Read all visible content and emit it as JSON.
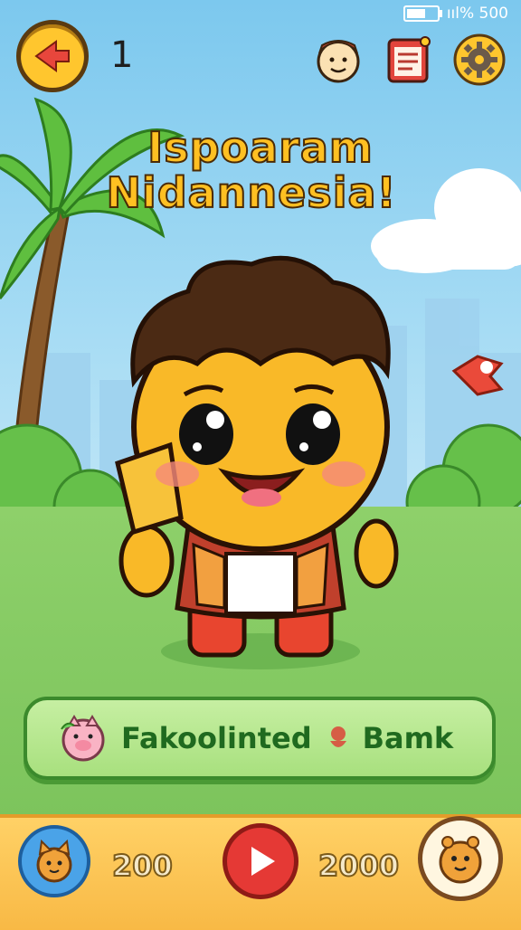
{
  "status": {
    "signal_text": "ııl% 500"
  },
  "header": {
    "level": "1",
    "icons": [
      "back-arrow-icon",
      "character-face-icon",
      "notebook-icon",
      "gear-icon"
    ]
  },
  "title": {
    "line1": "Ispoaram",
    "line2": "Nidannesia!"
  },
  "banner": {
    "text1": "Fakoolinted",
    "text2": "Bamk"
  },
  "bottom_bar": {
    "score_left": "200",
    "score_right": "2000"
  },
  "colors": {
    "gold": "#ffc62e",
    "play_red": "#e53935",
    "grass": "#8ed06a",
    "sky": "#7cc8ee"
  }
}
